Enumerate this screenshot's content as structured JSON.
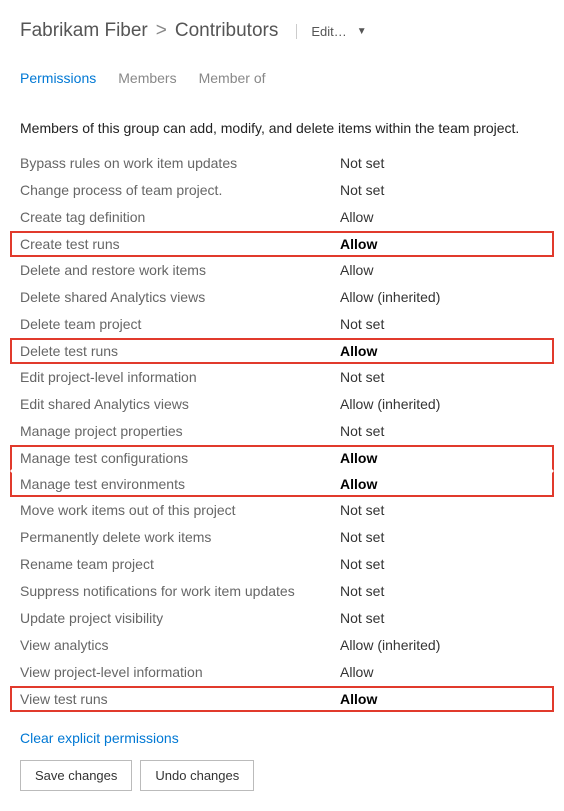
{
  "breadcrumb": {
    "project": "Fabrikam Fiber",
    "separator": ">",
    "group": "Contributors",
    "edit_label": "Edit…"
  },
  "tabs": {
    "permissions": "Permissions",
    "members": "Members",
    "member_of": "Member of"
  },
  "description": "Members of this group can add, modify, and delete items within the team project.",
  "permissions": [
    {
      "label": "Bypass rules on work item updates",
      "value": "Not set",
      "bold": false,
      "highlight": false
    },
    {
      "label": "Change process of team project.",
      "value": "Not set",
      "bold": false,
      "highlight": false
    },
    {
      "label": "Create tag definition",
      "value": "Allow",
      "bold": false,
      "highlight": false
    },
    {
      "label": "Create test runs",
      "value": "Allow",
      "bold": true,
      "highlight": true
    },
    {
      "label": "Delete and restore work items",
      "value": "Allow",
      "bold": false,
      "highlight": false
    },
    {
      "label": "Delete shared Analytics views",
      "value": "Allow (inherited)",
      "bold": false,
      "highlight": false
    },
    {
      "label": "Delete team project",
      "value": "Not set",
      "bold": false,
      "highlight": false
    },
    {
      "label": "Delete test runs",
      "value": "Allow",
      "bold": true,
      "highlight": true
    },
    {
      "label": "Edit project-level information",
      "value": "Not set",
      "bold": false,
      "highlight": false
    },
    {
      "label": "Edit shared Analytics views",
      "value": "Allow (inherited)",
      "bold": false,
      "highlight": false
    },
    {
      "label": "Manage project properties",
      "value": "Not set",
      "bold": false,
      "highlight": false
    },
    {
      "label": "Manage test configurations",
      "value": "Allow",
      "bold": true,
      "highlight": true
    },
    {
      "label": "Manage test environments",
      "value": "Allow",
      "bold": true,
      "highlight": true
    },
    {
      "label": "Move work items out of this project",
      "value": "Not set",
      "bold": false,
      "highlight": false
    },
    {
      "label": "Permanently delete work items",
      "value": "Not set",
      "bold": false,
      "highlight": false
    },
    {
      "label": "Rename team project",
      "value": "Not set",
      "bold": false,
      "highlight": false
    },
    {
      "label": "Suppress notifications for work item updates",
      "value": "Not set",
      "bold": false,
      "highlight": false
    },
    {
      "label": "Update project visibility",
      "value": "Not set",
      "bold": false,
      "highlight": false
    },
    {
      "label": "View analytics",
      "value": "Allow (inherited)",
      "bold": false,
      "highlight": false
    },
    {
      "label": "View project-level information",
      "value": "Allow",
      "bold": false,
      "highlight": false
    },
    {
      "label": "View test runs",
      "value": "Allow",
      "bold": true,
      "highlight": true
    }
  ],
  "actions": {
    "clear_permissions": "Clear explicit permissions",
    "save": "Save changes",
    "undo": "Undo changes"
  },
  "highlight_groups": [
    [
      3,
      3
    ],
    [
      7,
      7
    ],
    [
      11,
      12
    ],
    [
      20,
      20
    ]
  ]
}
